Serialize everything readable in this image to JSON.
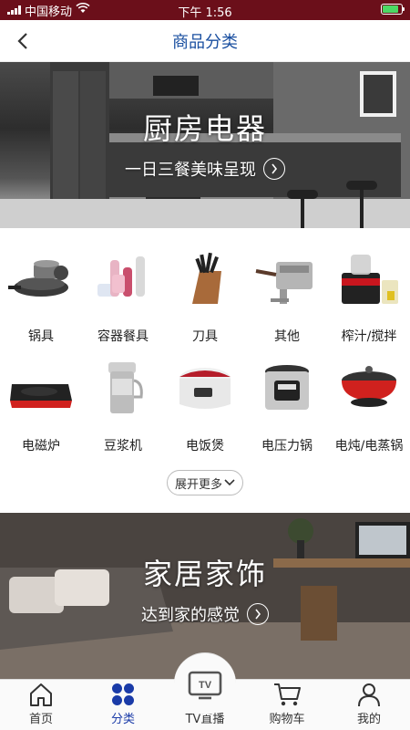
{
  "status_bar": {
    "carrier": "中国移动",
    "time": "下午 1:56"
  },
  "nav": {
    "title": "商品分类"
  },
  "banner_kitchen": {
    "title": "厨房电器",
    "subtitle": "一日三餐美味呈现"
  },
  "categories": [
    {
      "label": "锅具",
      "icon": "cookware-icon"
    },
    {
      "label": "容器餐具",
      "icon": "containers-icon"
    },
    {
      "label": "刀具",
      "icon": "knife-block-icon"
    },
    {
      "label": "其他",
      "icon": "pasta-maker-icon"
    },
    {
      "label": "榨汁/搅拌",
      "icon": "juicer-icon"
    },
    {
      "label": "电磁炉",
      "icon": "induction-cooker-icon"
    },
    {
      "label": "豆浆机",
      "icon": "soymilk-maker-icon"
    },
    {
      "label": "电饭煲",
      "icon": "rice-cooker-icon"
    },
    {
      "label": "电压力锅",
      "icon": "pressure-cooker-icon"
    },
    {
      "label": "电炖/电蒸锅",
      "icon": "electric-stewpot-icon"
    }
  ],
  "expand": {
    "label": "展开更多"
  },
  "banner_home": {
    "title": "家居家饰",
    "subtitle": "达到家的感觉"
  },
  "tabs": [
    {
      "label": "首页",
      "icon": "home-icon"
    },
    {
      "label": "分类",
      "icon": "category-icon"
    },
    {
      "label": "TV直播",
      "icon": "tv-icon"
    },
    {
      "label": "购物车",
      "icon": "cart-icon"
    },
    {
      "label": "我的",
      "icon": "user-icon"
    }
  ],
  "colors": {
    "status_bar": "#6b0f1a",
    "accent": "#1a3ba8",
    "title": "#1a4fa0"
  }
}
